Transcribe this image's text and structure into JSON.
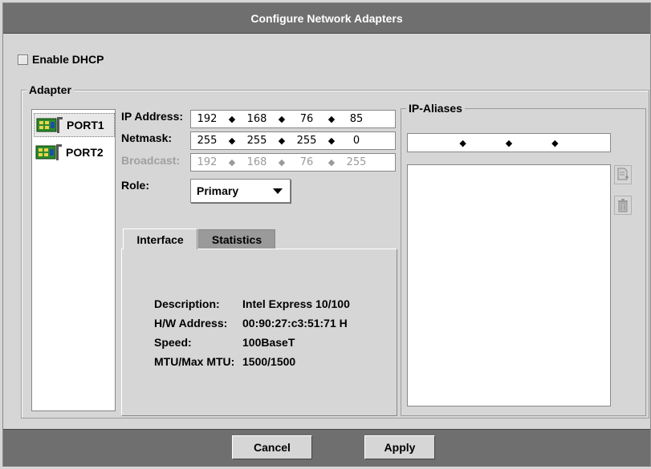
{
  "window": {
    "title": "Configure Network Adapters"
  },
  "dhcp": {
    "label": "Enable DHCP",
    "checked": false
  },
  "adapter": {
    "group_label": "Adapter",
    "ports": [
      {
        "label": "PORT1",
        "selected": true,
        "icon": "network-card-icon"
      },
      {
        "label": "PORT2",
        "selected": false,
        "icon": "network-card-icon"
      }
    ],
    "ip_address": {
      "label": "IP Address:",
      "octets": [
        "192",
        "168",
        "76",
        "85"
      ]
    },
    "netmask": {
      "label": "Netmask:",
      "octets": [
        "255",
        "255",
        "255",
        "0"
      ]
    },
    "broadcast": {
      "label": "Broadcast:",
      "octets": [
        "192",
        "168",
        "76",
        "255"
      ],
      "disabled": true
    },
    "role": {
      "label": "Role:",
      "value": "Primary"
    },
    "tabs": [
      {
        "label": "Interface",
        "active": true
      },
      {
        "label": "Statistics",
        "active": false
      }
    ],
    "interface": {
      "description": {
        "key": "Description:",
        "value": "Intel Express 10/100"
      },
      "hw_address": {
        "key": "H/W Address:",
        "value": "00:90:27:c3:51:71 H"
      },
      "speed": {
        "key": "Speed:",
        "value": "100BaseT"
      },
      "mtu": {
        "key": "MTU/Max MTU:",
        "value": "1500/1500"
      }
    }
  },
  "ip_aliases": {
    "group_label": "IP-Aliases",
    "add_icon": "add-document-icon",
    "delete_icon": "trash-icon"
  },
  "footer": {
    "cancel_label": "Cancel",
    "apply_label": "Apply"
  }
}
